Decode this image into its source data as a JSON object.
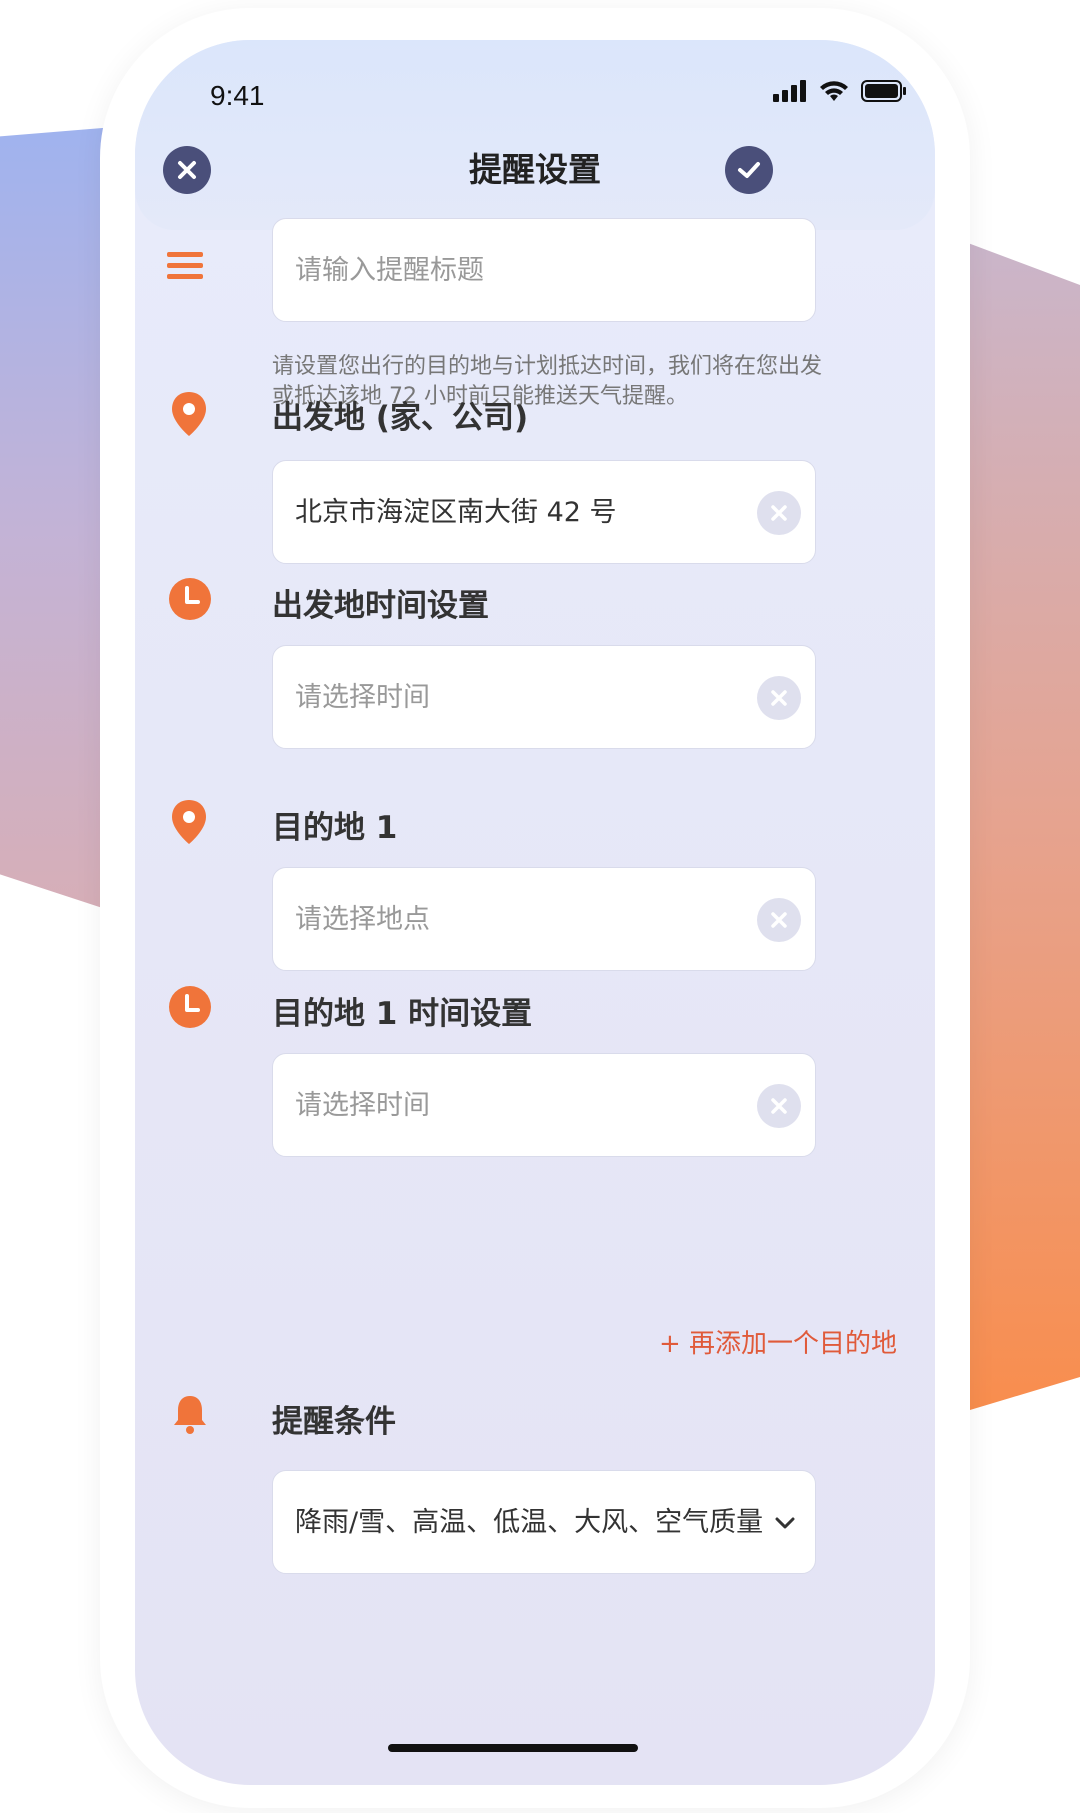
{
  "status": {
    "time": "9:41"
  },
  "header": {
    "title": "提醒设置"
  },
  "form": {
    "title_placeholder": "请输入提醒标题",
    "hint": "请设置您出行的目的地与计划抵达时间，我们将在您出发或抵达该地 72 小时前只能推送天气提醒。",
    "origin_label": "出发地 (家、公司)",
    "origin_value": "北京市海淀区南大街 42 号",
    "origin_time_label": "出发地时间设置",
    "origin_time_placeholder": "请选择时间",
    "dest1_label": "目的地 1",
    "dest1_placeholder": "请选择地点",
    "dest1_time_label": "目的地 1 时间设置",
    "dest1_time_placeholder": "请选择时间",
    "add_destination": "+ 再添加一个目的地",
    "conditions_label": "提醒条件",
    "conditions_value": "降雨/雪、高温、低温、大风、空气质量"
  },
  "colors": {
    "accent_orange": "#f0743a",
    "nav_button": "#4a4f7a",
    "link_red": "#e05a3a"
  },
  "icons": {
    "close": "close-icon",
    "confirm": "check-icon",
    "menu": "menu-icon",
    "location": "location-pin-icon",
    "clock": "clock-icon",
    "bell": "bell-icon",
    "clear": "clear-icon",
    "dropdown": "chevron-down-icon"
  }
}
